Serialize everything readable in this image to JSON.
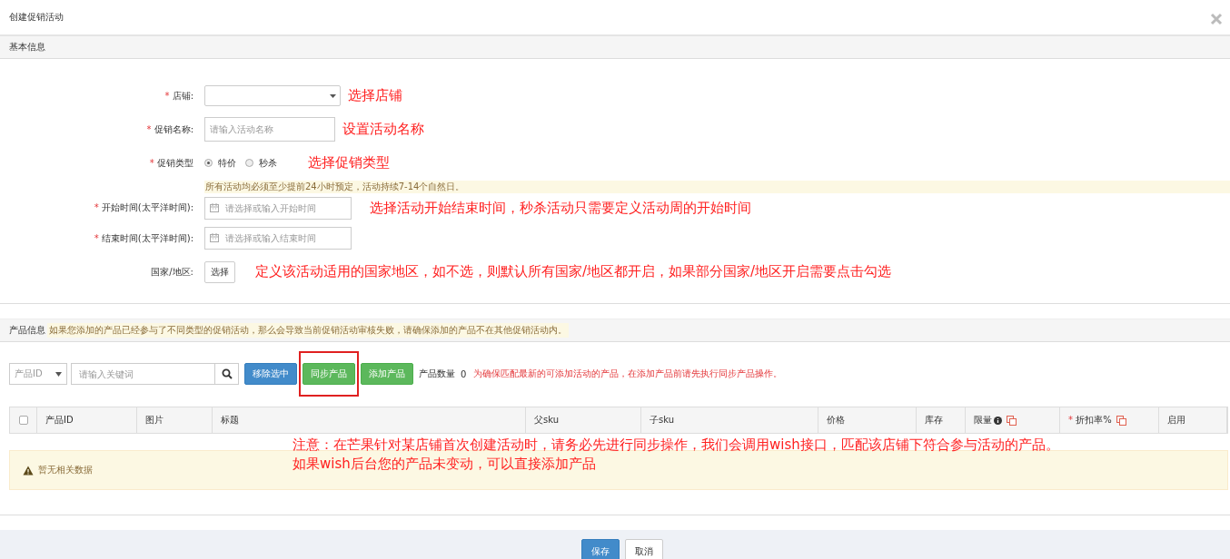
{
  "dialog": {
    "title": "创建促销活动"
  },
  "basic_section": {
    "title": "基本信息"
  },
  "form": [
    {
      "kind": "select",
      "label": "店铺:",
      "required_mark": "*",
      "annotation": "选择店铺"
    },
    {
      "kind": "text",
      "label": "促销名称:",
      "required_mark": "*",
      "placeholder": "请输入活动名称",
      "annotation": "设置活动名称"
    },
    {
      "kind": "radio",
      "label": "促销类型",
      "required_mark": "*",
      "options": [
        {
          "label": "特价",
          "selected": true
        },
        {
          "label": "秒杀",
          "selected": false
        }
      ],
      "annotation": "选择促销类型"
    },
    {
      "kind": "date",
      "label": "开始时间(太平洋时间):",
      "required_mark": "*",
      "notice": "所有活动均必须至少提前24小时预定，活动持续7-14个自然日。",
      "placeholder": "请选择或输入开始时间",
      "annotation": "选择活动开始结束时间，秒杀活动只需要定义活动周的开始时间"
    },
    {
      "kind": "date",
      "label": "结束时间(太平洋时间):",
      "required_mark": "*",
      "placeholder": "请选择或输入结束时间"
    },
    {
      "kind": "button",
      "label": "国家/地区:",
      "button": "选择",
      "annotation": "定义该活动适用的国家地区，如不选，则默认所有国家/地区都开启，如果部分国家/地区开启需要点击勾选"
    }
  ],
  "product_section": {
    "title": "产品信息",
    "warning": "如果您添加的产品已经参与了不同类型的促销活动，那么会导致当前促销活动审核失败，请确保添加的产品不在其他促销活动内。"
  },
  "toolbar": {
    "filter": "产品ID",
    "search_placeholder": "请输入关键词",
    "buttons": [
      {
        "label": "移除选中",
        "kind": "primary",
        "highlighted": false
      },
      {
        "label": "同步产品",
        "kind": "success",
        "highlighted": true
      },
      {
        "label": "添加产品",
        "kind": "success",
        "highlighted": false
      }
    ],
    "count_label": "产品数量",
    "count": "0",
    "hint": "为确保匹配最新的可添加活动的产品，在添加产品前请先执行同步产品操作。"
  },
  "table": {
    "select_all": {
      "checked": false
    },
    "columns": [
      {
        "label": "产品ID"
      },
      {
        "label": "图片"
      },
      {
        "label": "标题"
      },
      {
        "label": "父sku"
      },
      {
        "label": "子sku"
      },
      {
        "label": "价格"
      },
      {
        "label": "库存"
      },
      {
        "label": "限量",
        "icons": [
          {
            "kind": "info"
          },
          {
            "kind": "copy"
          }
        ]
      },
      {
        "label": "折扣率%",
        "required_mark": "*",
        "icons": [
          {
            "kind": "copy"
          }
        ]
      },
      {
        "label": "启用"
      }
    ],
    "empty": "暂无相关数据"
  },
  "note": [
    "注意：在芒果针对某店铺首次创建活动时，请务必先进行同步操作，我们会调用wish接口，匹配该店铺下符合参与活动的产品。",
    "如果wish后台您的产品未变动，可以直接添加产品"
  ],
  "footer": {
    "buttons": [
      {
        "label": "保存",
        "kind": "primary"
      },
      {
        "label": "取消",
        "kind": "default"
      }
    ]
  }
}
